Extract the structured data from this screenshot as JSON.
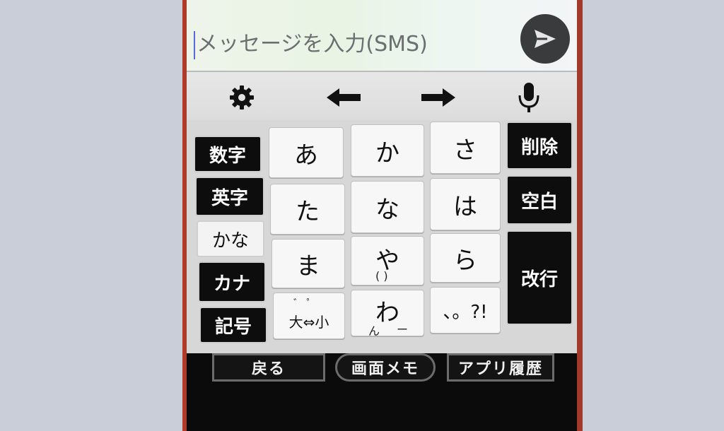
{
  "message": {
    "placeholder": "メッセージを入力(SMS)"
  },
  "toolbar": {
    "settings_icon": "gear-icon",
    "left_icon": "arrow-left-icon",
    "right_icon": "arrow-right-icon",
    "mic_icon": "microphone-icon",
    "send_icon": "send-icon"
  },
  "keyboard": {
    "left_keys": [
      "数字",
      "英字",
      "かな",
      "カナ",
      "記号"
    ],
    "active_mode": "かな",
    "kana_keys": [
      "あ",
      "か",
      "さ",
      "た",
      "な",
      "は",
      "ま",
      "や",
      "ら",
      "大⇔小",
      "わ",
      "、。?!"
    ],
    "ya_sub": "(   )",
    "wa_sub_left": "ん",
    "wa_sub_right": "ー",
    "dakuten_marks": "゛ ゜",
    "right_keys": [
      "削除",
      "空白",
      "改行"
    ]
  },
  "bottom": {
    "back": "戻る",
    "memo": "画面メモ",
    "history": "アプリ履歴"
  },
  "colors": {
    "accent_caret": "#5a6ad8",
    "send_button": "#3a3b3d",
    "side_key_bg": "#0d0d0d"
  }
}
